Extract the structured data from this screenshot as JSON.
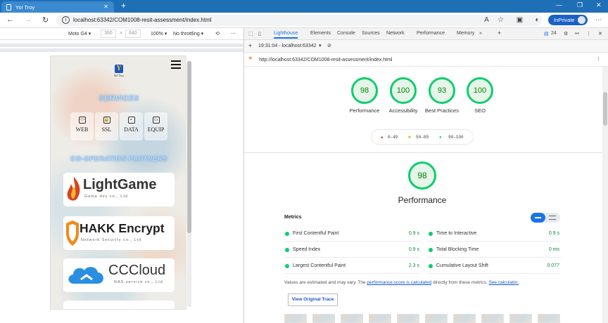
{
  "browser": {
    "tab_title": "Yo! Troy",
    "tab_close": "✕",
    "new_tab": "+",
    "url": "localhost:63342/COM1008-resit-assessment/index.html",
    "inprivate_label": "InPrivate"
  },
  "device_toolbar": {
    "device": "Moto G4 ▾",
    "width": "360",
    "height": "640",
    "zoom": "100% ▾",
    "throttling": "No throttling ▾"
  },
  "page": {
    "logo_letter": "Y",
    "logo_text": "Yo! Troy",
    "services_title": "SERVICES",
    "services": [
      {
        "icon": "</>",
        "label": "WEB"
      },
      {
        "icon": "🔒",
        "label": "SSL"
      },
      {
        "icon": "≡",
        "label": "DATA"
      },
      {
        "icon": "▭",
        "label": "EQUIP"
      }
    ],
    "partners_title": "CO-OPERATION PARTNERS",
    "partners": [
      {
        "name": "LightGame",
        "sub": "Game dev co., Ltd",
        "color": "#d64521"
      },
      {
        "name": "HAKK Encrypt",
        "sub": "Network Security co., Ltd",
        "color": "#f08a1c"
      },
      {
        "name": "CCCloud",
        "sub": "NAS service co., Ltd",
        "color": "#2a8fe0"
      }
    ]
  },
  "devtools": {
    "tabs": [
      "Lighthouse",
      "Elements",
      "Console",
      "Sources",
      "Network",
      "Performance",
      "Memory"
    ],
    "issues_count": "24",
    "report_time": "19:31:04 - localhost:63342",
    "report_url": "http://localhost:63342/COM1008-resit-assessment/index.html",
    "scores": [
      {
        "value": "98",
        "label": "Performance"
      },
      {
        "value": "100",
        "label": "Accessibility"
      },
      {
        "value": "93",
        "label": "Best Practices"
      },
      {
        "value": "100",
        "label": "SEO"
      }
    ],
    "legend": {
      "low": "0–49",
      "mid": "50–89",
      "high": "90–100"
    },
    "perf_score": "98",
    "perf_title": "Performance",
    "metrics_title": "Metrics",
    "metrics_left": [
      {
        "label": "First Contentful Paint",
        "value": "0.9 s"
      },
      {
        "label": "Speed Index",
        "value": "0.9 s"
      },
      {
        "label": "Largest Contentful Paint",
        "value": "2.3 s"
      }
    ],
    "metrics_right": [
      {
        "label": "Time to Interactive",
        "value": "0.9 s"
      },
      {
        "label": "Total Blocking Time",
        "value": "0 ms"
      },
      {
        "label": "Cumulative Layout Shift",
        "value": "0.077"
      }
    ],
    "note_prefix": "Values are estimated and may vary. The ",
    "note_link1": "performance score is calculated",
    "note_mid": " directly from these metrics. ",
    "note_link2": "See calculator.",
    "view_trace": "View Original Trace"
  },
  "colors": {
    "pass": "#0cce6b",
    "accent": "#1a73e8",
    "titlebar": "#1f6fb7"
  }
}
